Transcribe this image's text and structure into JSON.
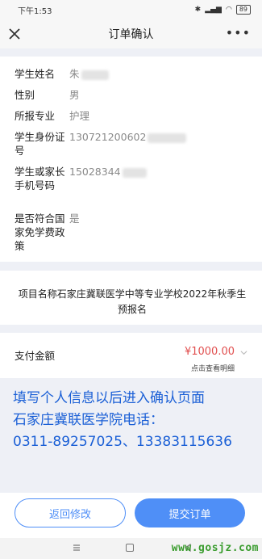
{
  "status_bar": {
    "time": "下午1:53",
    "battery": "89"
  },
  "nav": {
    "title": "订单确认",
    "more": "•••"
  },
  "student": {
    "name_label": "学生姓名",
    "name_value": "朱",
    "gender_label": "性别",
    "gender_value": "男",
    "major_label": "所报专业",
    "major_value": "护理",
    "id_label": "学生身份证号",
    "id_value": "130721200602",
    "phone_label": "学生或家长手机号码",
    "phone_value": "15028344",
    "policy_label": "是否符合国家免学费政策",
    "policy_value": "是"
  },
  "project": {
    "text": "项目名称石家庄冀联医学中等专业学校2022年秋季生预报名"
  },
  "payment": {
    "label": "支付金额",
    "amount": "¥1000.00",
    "detail_link": "点击查看明细"
  },
  "overlay_note": {
    "line1": "填写个人信息以后进入确认页面",
    "line2": "石家庄冀联医学院电话：",
    "line3": "0311-89257025、13383115636"
  },
  "actions": {
    "back_label": "返回修改",
    "submit_label": "提交订单"
  },
  "watermark": "www.gosjz.com",
  "colors": {
    "accent": "#4f8ff7",
    "price": "#e14f4f",
    "overlay_text": "#1a5fd6",
    "watermark": "#3a9c2e"
  }
}
